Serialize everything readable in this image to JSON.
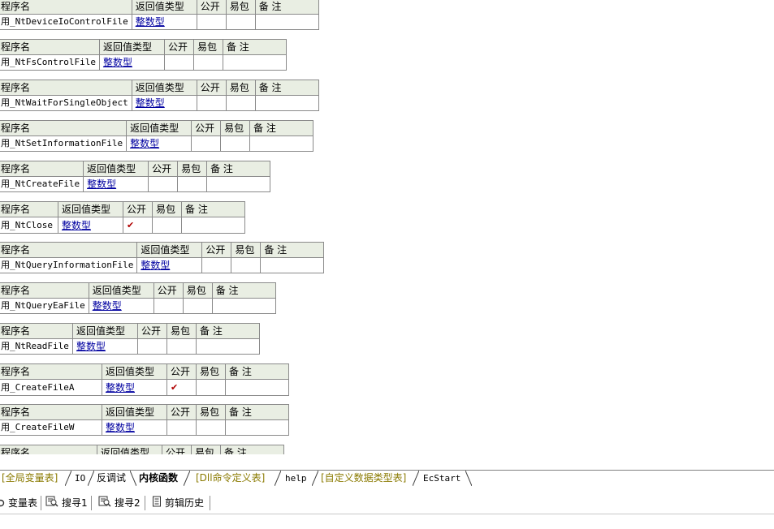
{
  "headers": {
    "name": "程序名",
    "ret": "返回值类型",
    "pub": "公开",
    "easy": "易包",
    "note": "备 注"
  },
  "subs": [
    {
      "name": "用_NtDeviceIoControlFile",
      "ret": "整数型",
      "pub": "",
      "easy": "",
      "note": ""
    },
    {
      "name": "用_NtFsControlFile",
      "ret": "整数型",
      "pub": "",
      "easy": "",
      "note": ""
    },
    {
      "name": "用_NtWaitForSingleObject",
      "ret": "整数型",
      "pub": "",
      "easy": "",
      "note": ""
    },
    {
      "name": "用_NtSetInformationFile",
      "ret": "整数型",
      "pub": "",
      "easy": "",
      "note": ""
    },
    {
      "name": "用_NtCreateFile",
      "ret": "整数型",
      "pub": "",
      "easy": "",
      "note": ""
    },
    {
      "name": "用_NtClose",
      "ret": "整数型",
      "pub": "✔",
      "easy": "",
      "note": ""
    },
    {
      "name": "用_NtQueryInformationFile",
      "ret": "整数型",
      "pub": "",
      "easy": "",
      "note": ""
    },
    {
      "name": "用_NtQueryEaFile",
      "ret": "整数型",
      "pub": "",
      "easy": "",
      "note": ""
    },
    {
      "name": "用_NtReadFile",
      "ret": "整数型",
      "pub": "",
      "easy": "",
      "note": ""
    },
    {
      "name": "用_CreateFileA",
      "ret": "整数型",
      "pub": "✔",
      "easy": "",
      "note": ""
    },
    {
      "name": "用_CreateFileW",
      "ret": "整数型",
      "pub": "",
      "easy": "",
      "note": ""
    }
  ],
  "tabs": [
    {
      "label": "[全局变量表]",
      "style": "olive"
    },
    {
      "label": "IO",
      "style": "mono"
    },
    {
      "label": "反调试",
      "style": ""
    },
    {
      "label": "内核函数",
      "style": "active"
    },
    {
      "label": "[Dll命令定义表]",
      "style": "olive"
    },
    {
      "label": "help",
      "style": "mono"
    },
    {
      "label": "[自定义数据类型表]",
      "style": "olive"
    },
    {
      "label": "EcStart",
      "style": "mono"
    }
  ],
  "bottom_tools": [
    {
      "label": "变量表",
      "icon": "variable-table-icon"
    },
    {
      "label": "搜寻1",
      "icon": "search-1-icon"
    },
    {
      "label": "搜寻2",
      "icon": "search-2-icon"
    },
    {
      "label": "剪辑历史",
      "icon": "clip-history-icon"
    }
  ],
  "colors": {
    "header_bg": "#e9eee3",
    "link": "#0000a0",
    "check": "#b00000",
    "tab_olive": "#8a7a00"
  }
}
